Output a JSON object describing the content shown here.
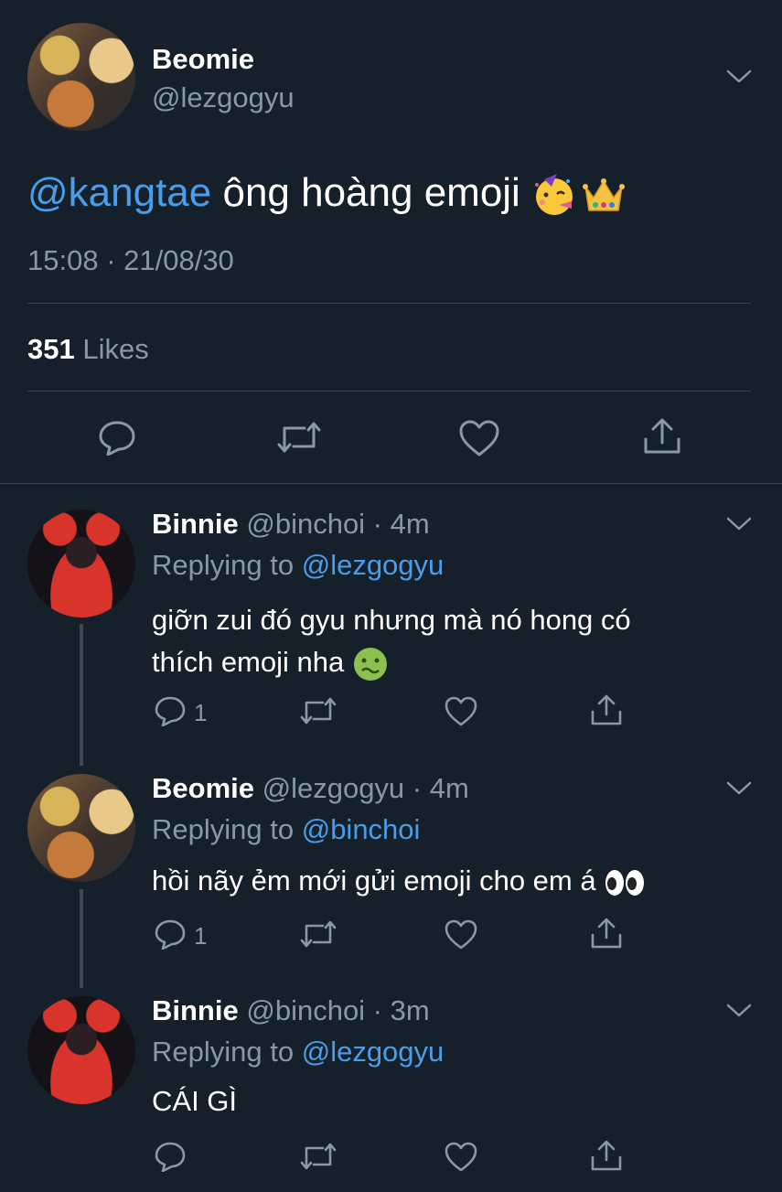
{
  "main_tweet": {
    "name": "Beomie",
    "handle": "@lezgogyu",
    "mention": "@kangtae",
    "text": " ông hoàng emoji ",
    "emojis": [
      "partying-face-icon",
      "crown-icon"
    ],
    "timestamp": "15:08 · 21/08/30",
    "likes_count": "351",
    "likes_label": "Likes"
  },
  "replies": [
    {
      "name": "Binnie",
      "handle": "@binchoi · 4m",
      "replying_label": "Replying to ",
      "replying_to": "@lezgogyu",
      "text_line1": "giỡn zui đó gyu nhưng mà nó hong có",
      "text_line2": "thích emoji nha ",
      "emoji": "nauseated-face-icon",
      "reply_count": "1"
    },
    {
      "name": "Beomie",
      "handle": "@lezgogyu · 4m",
      "replying_label": "Replying to ",
      "replying_to": "@binchoi",
      "text_line1": "hồi nãy ẻm mới gửi emoji cho em á ",
      "emoji": "eyes-icon",
      "reply_count": "1"
    },
    {
      "name": "Binnie",
      "handle": "@binchoi · 3m",
      "replying_label": "Replying to ",
      "replying_to": "@lezgogyu",
      "text_line1": "CÁI GÌ",
      "reply_count": ""
    }
  ],
  "colors": {
    "background": "#15202b",
    "link": "#4a9de8",
    "muted": "#8899a6",
    "divider": "#38444d"
  }
}
